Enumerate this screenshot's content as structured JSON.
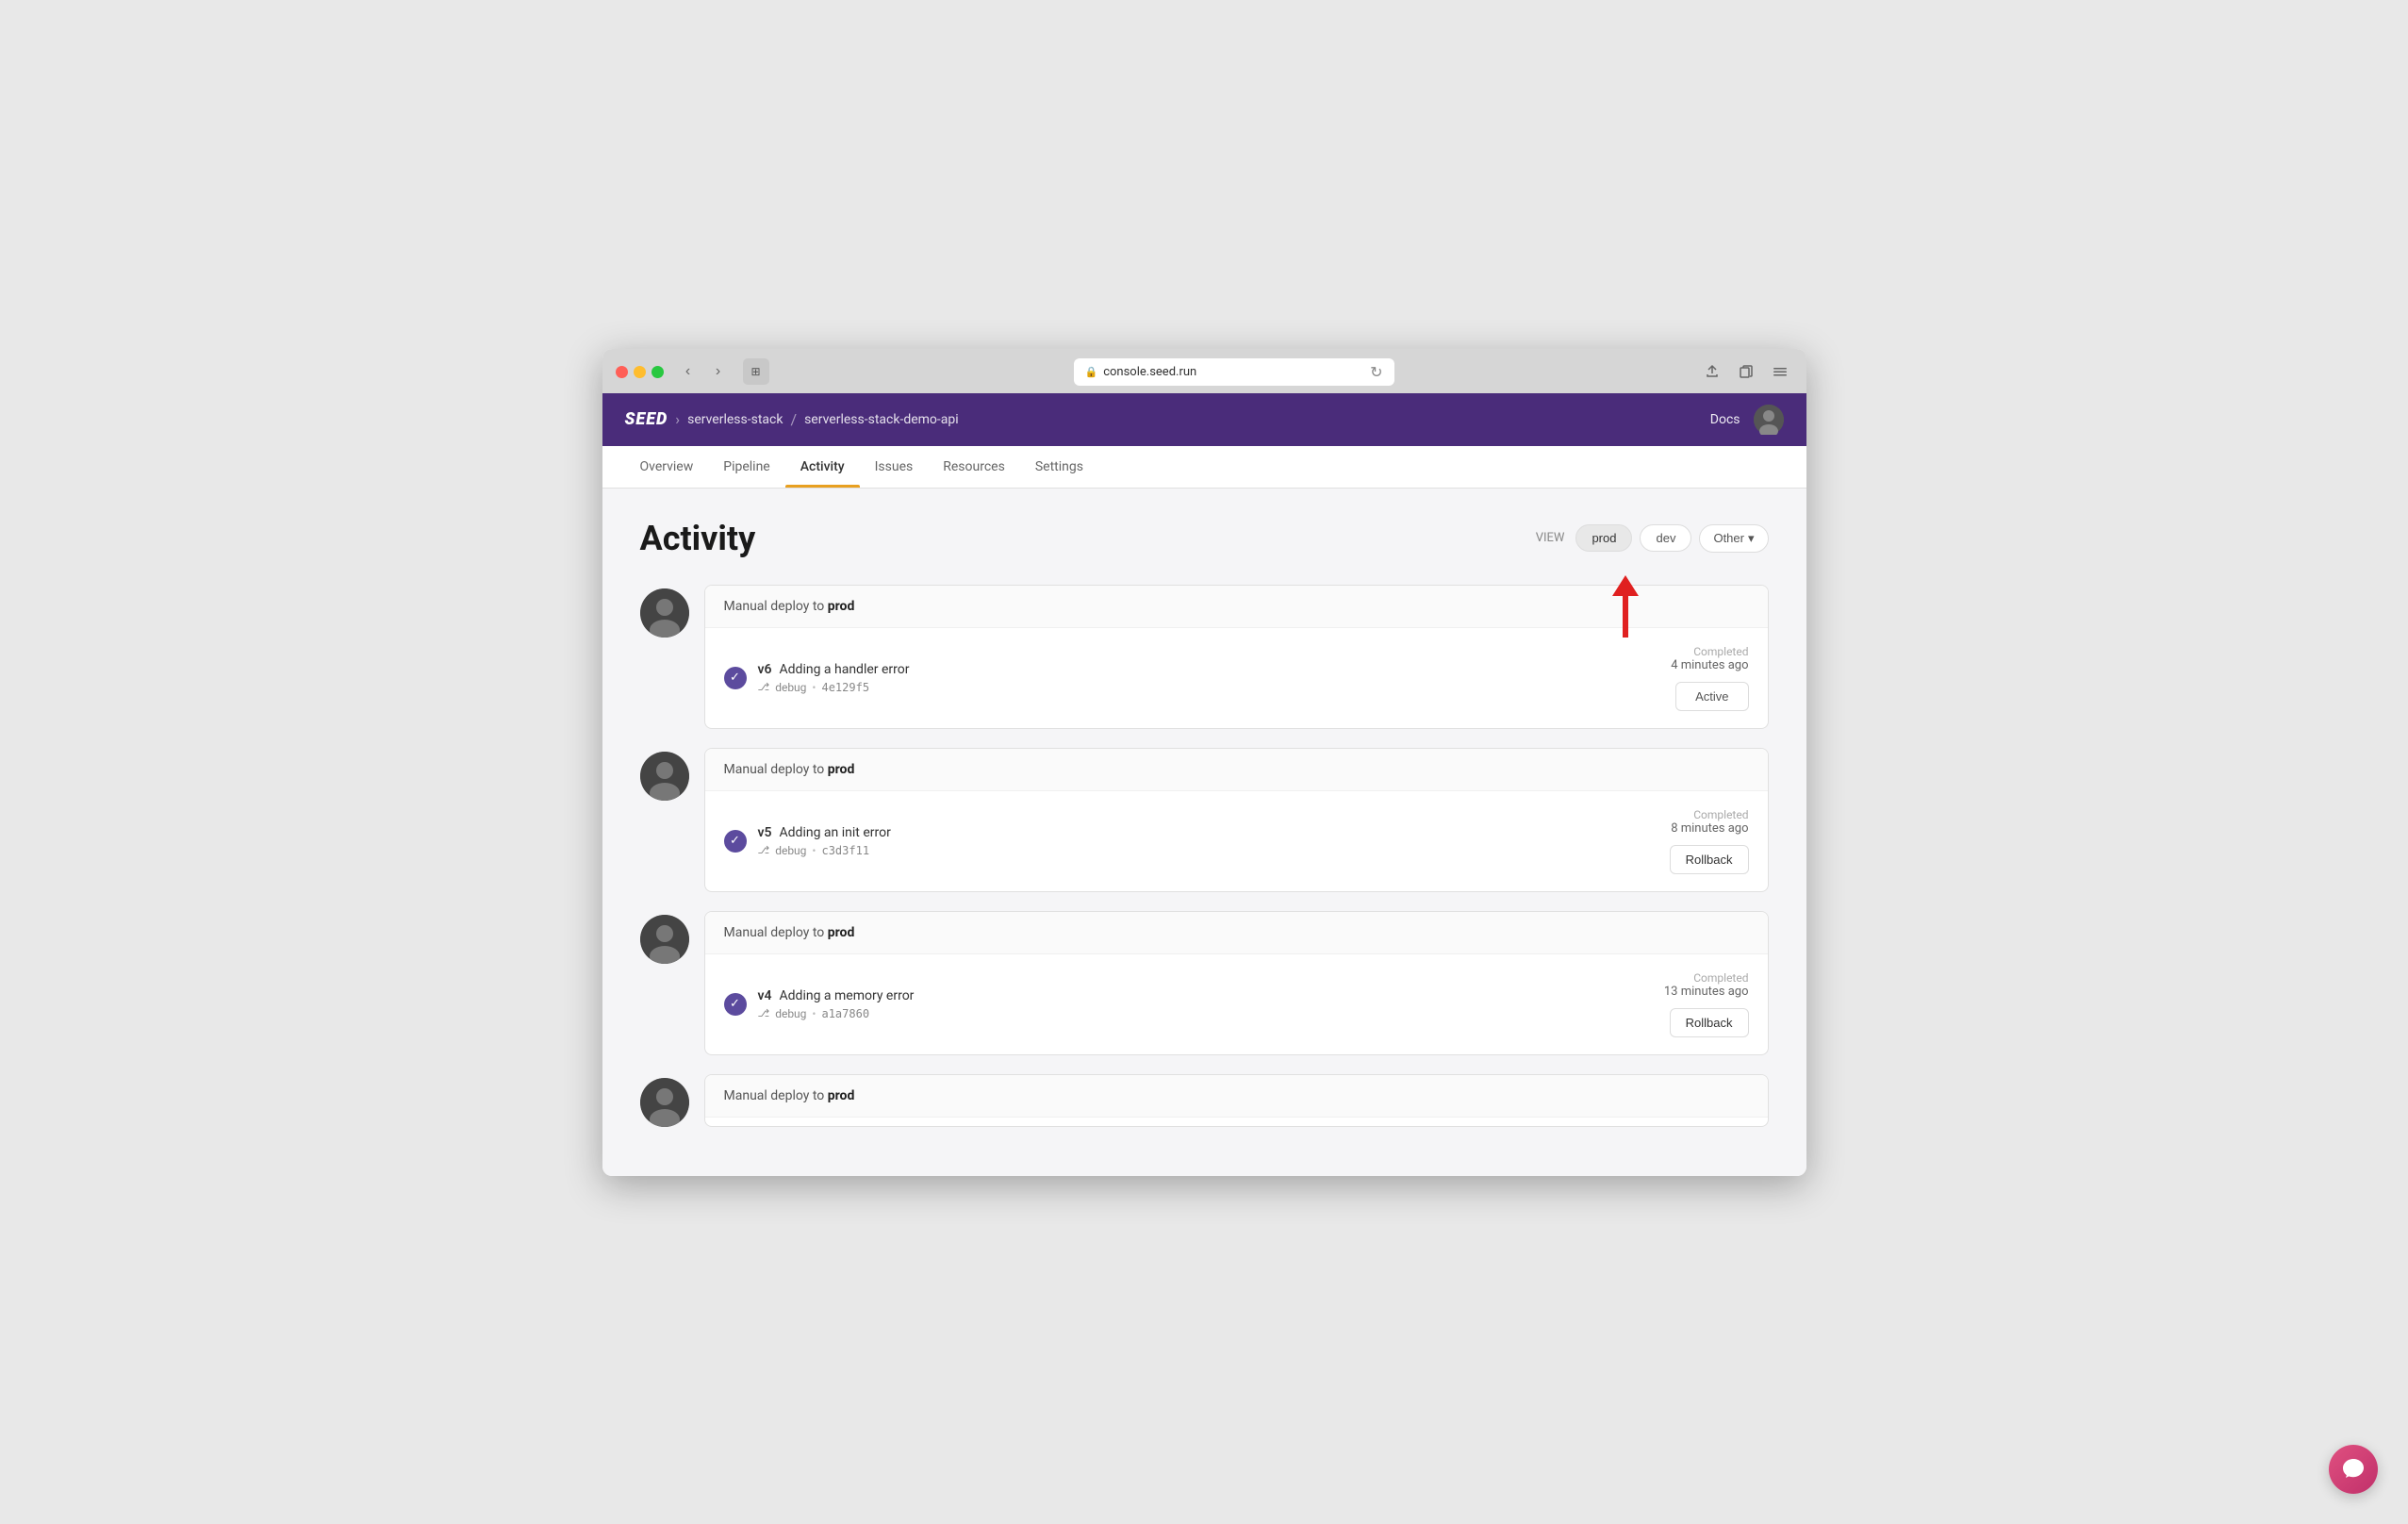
{
  "browser": {
    "url": "console.seed.run",
    "reload_title": "Reload"
  },
  "header": {
    "logo": "SEED",
    "breadcrumb": [
      {
        "label": "serverless-stack"
      },
      {
        "separator": "/"
      },
      {
        "label": "serverless-stack-demo-api"
      }
    ],
    "docs_label": "Docs"
  },
  "nav": {
    "tabs": [
      {
        "label": "Overview",
        "active": false
      },
      {
        "label": "Pipeline",
        "active": false
      },
      {
        "label": "Activity",
        "active": true
      },
      {
        "label": "Issues",
        "active": false
      },
      {
        "label": "Resources",
        "active": false
      },
      {
        "label": "Settings",
        "active": false
      }
    ]
  },
  "page": {
    "title": "Activity",
    "view_label": "VIEW",
    "filters": [
      {
        "label": "prod",
        "active": true
      },
      {
        "label": "dev",
        "active": false
      },
      {
        "label": "Other",
        "active": false,
        "has_dropdown": true
      }
    ]
  },
  "activities": [
    {
      "id": 1,
      "header": "Manual deploy to ",
      "header_bold": "prod",
      "version": "v6",
      "message": "Adding a handler error",
      "branch": "debug",
      "commit": "4e129f5",
      "status": "Completed",
      "time": "4 minutes ago",
      "action": "Active",
      "is_active": true
    },
    {
      "id": 2,
      "header": "Manual deploy to ",
      "header_bold": "prod",
      "version": "v5",
      "message": "Adding an init error",
      "branch": "debug",
      "commit": "c3d3f11",
      "status": "Completed",
      "time": "8 minutes ago",
      "action": "Rollback",
      "is_active": false
    },
    {
      "id": 3,
      "header": "Manual deploy to ",
      "header_bold": "prod",
      "version": "v4",
      "message": "Adding a memory error",
      "branch": "debug",
      "commit": "a1a7860",
      "status": "Completed",
      "time": "13 minutes ago",
      "action": "Rollback",
      "is_active": false
    },
    {
      "id": 4,
      "header": "Manual deploy to ",
      "header_bold": "prod",
      "version": "",
      "message": "",
      "branch": "",
      "commit": "",
      "status": "",
      "time": "",
      "action": "",
      "is_active": false,
      "partial": true
    }
  ],
  "chat": {
    "icon": "💬"
  }
}
